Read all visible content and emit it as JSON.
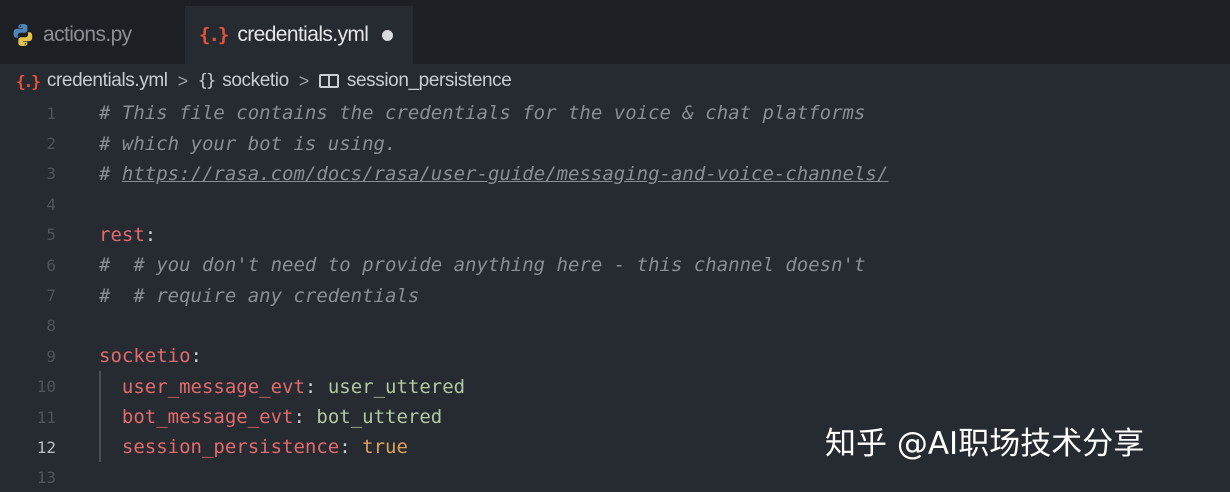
{
  "tabs": [
    {
      "label": "actions.py",
      "icon": "python-file-icon",
      "active": false
    },
    {
      "label": "credentials.yml",
      "icon": "yaml-file-icon",
      "active": true,
      "modified": true
    }
  ],
  "breadcrumb": {
    "file": "credentials.yml",
    "section": "socketio",
    "property": "session_persistence",
    "yml_icon_text": "{.}",
    "object_icon_text": "{}",
    "separator": ">"
  },
  "code_lines": [
    {
      "n": "1",
      "comment": "# This file contains the credentials for the voice & chat platforms"
    },
    {
      "n": "2",
      "comment": "# which your bot is using."
    },
    {
      "n": "3",
      "comment_prefix": "# ",
      "url": "https://rasa.com/docs/rasa/user-guide/messaging-and-voice-channels/"
    },
    {
      "n": "4"
    },
    {
      "n": "5",
      "key": "rest",
      "colon": ":"
    },
    {
      "n": "6",
      "comment": "#  # you don't need to provide anything here - this channel doesn't"
    },
    {
      "n": "7",
      "comment": "#  # require any credentials"
    },
    {
      "n": "8"
    },
    {
      "n": "9",
      "key": "socketio",
      "colon": ":"
    },
    {
      "n": "10",
      "indent": "  ",
      "key": "user_message_evt",
      "colon": ": ",
      "value": "user_uttered"
    },
    {
      "n": "11",
      "indent": "  ",
      "key": "bot_message_evt",
      "colon": ": ",
      "value": "bot_uttered"
    },
    {
      "n": "12",
      "indent": "  ",
      "key": "session_persistence",
      "colon": ": ",
      "value": "true"
    },
    {
      "n": "13"
    }
  ],
  "watermark": "知乎 @AI职场技术分享",
  "colors": {
    "background": "#262a31",
    "tabbar": "#1c1f24",
    "comment": "#8a8f95",
    "key": "#e36b6b",
    "string_value": "#b2c9a0",
    "boolean": "#e0a25a",
    "yaml_icon": "#e2533a"
  }
}
